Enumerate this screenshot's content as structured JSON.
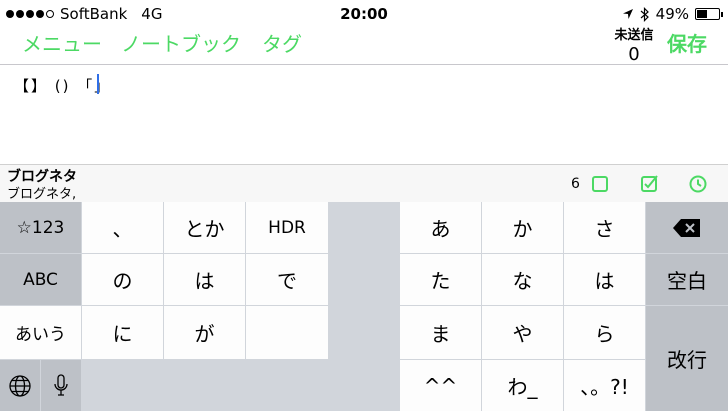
{
  "status_bar": {
    "carrier": "SoftBank",
    "network": "4G",
    "time": "20:00",
    "battery_percent": "49%",
    "battery_level": 0.49,
    "signal_dots_filled": 4,
    "signal_dots_total": 5
  },
  "nav": {
    "menu": "メニュー",
    "notebook": "ノートブック",
    "tag": "タグ",
    "unsent_label": "未送信",
    "unsent_count": "0",
    "save": "保存"
  },
  "editor": {
    "text": "【】 () 「」"
  },
  "suggestion": {
    "title": "ブログネタ",
    "subtitle": "ブログネタ,",
    "count": "6"
  },
  "colors": {
    "accent": "#4cd964",
    "cursor": "#2f6fe8"
  },
  "keyboard": {
    "left": {
      "numbers": "☆123",
      "abc": "ABC",
      "kana": "あいう"
    },
    "candidates": [
      "、",
      "とか",
      "HDR",
      "の",
      "は",
      "で",
      "に",
      "が"
    ],
    "kana_keys": [
      "あ",
      "か",
      "さ",
      "た",
      "な",
      "は",
      "ま",
      "や",
      "ら",
      "^^",
      "わ_",
      "、。?!"
    ],
    "space": "空白",
    "enter": "改行"
  }
}
